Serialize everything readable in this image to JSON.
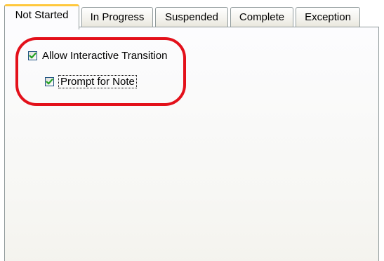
{
  "tabs": [
    {
      "label": "Not Started",
      "active": true
    },
    {
      "label": "In Progress",
      "active": false
    },
    {
      "label": "Suspended",
      "active": false
    },
    {
      "label": "Complete",
      "active": false
    },
    {
      "label": "Exception",
      "active": false
    }
  ],
  "options": {
    "allow_interactive_transition": {
      "label": "Allow Interactive Transition",
      "checked": true
    },
    "prompt_for_note": {
      "label": "Prompt for Note",
      "checked": true
    }
  },
  "colors": {
    "highlight_ring": "#e3101a",
    "checkmark": "#21a121",
    "active_tab_accent": "#ffc83c"
  }
}
